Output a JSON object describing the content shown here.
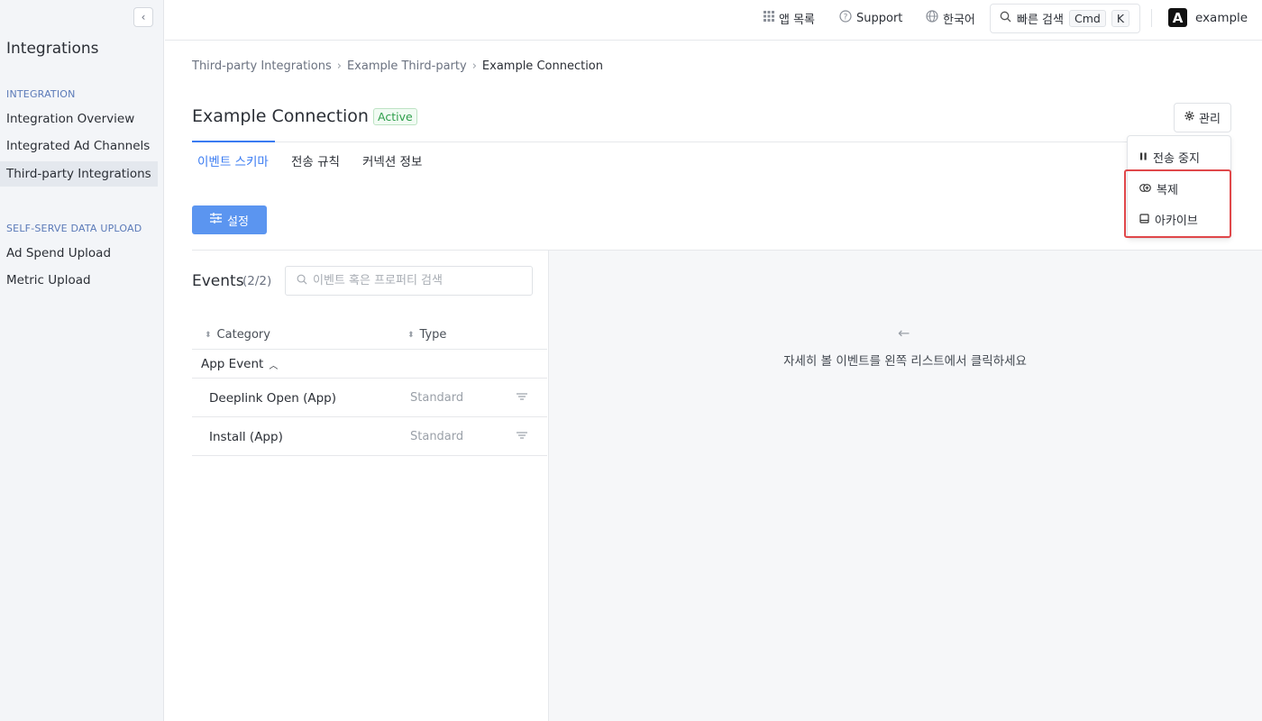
{
  "sidebar": {
    "title": "Integrations",
    "sections": [
      {
        "label": "INTEGRATION",
        "items": [
          "Integration Overview",
          "Integrated Ad Channels",
          "Third-party Integrations"
        ]
      },
      {
        "label": "SELF-SERVE DATA UPLOAD",
        "items": [
          "Ad Spend Upload",
          "Metric Upload"
        ]
      }
    ],
    "active_item": "Third-party Integrations"
  },
  "topbar": {
    "app_list": "앱 목록",
    "support": "Support",
    "language": "한국어",
    "quick_search": "빠른 검색",
    "kbd_cmd": "Cmd",
    "kbd_k": "K",
    "avatar_letter": "A",
    "user": "example"
  },
  "breadcrumb": [
    "Third-party Integrations",
    "Example Third-party",
    "Example Connection"
  ],
  "page": {
    "title": "Example Connection",
    "status": "Active",
    "manage_label": "관리"
  },
  "tabs": [
    "이벤트 스키마",
    "전송 규칙",
    "커넥션 정보"
  ],
  "settings_label": "설정",
  "events": {
    "title": "Events",
    "count": "(2/2)",
    "search_placeholder": "이벤트 혹은 프로퍼티 검색",
    "columns": [
      "Category",
      "Type"
    ],
    "group": "App Event",
    "rows": [
      {
        "name": "Deeplink Open (App)",
        "type": "Standard"
      },
      {
        "name": "Install (App)",
        "type": "Standard"
      }
    ]
  },
  "detail_pane": {
    "message": "자세히 볼 이벤트를 왼쪽 리스트에서 클릭하세요"
  },
  "dropdown": {
    "items": [
      "전송 중지",
      "복제",
      "아카이브"
    ]
  },
  "colors": {
    "accent": "#3a7bf2",
    "button": "#5b95f0",
    "status_green": "#2e9e4b",
    "highlight": "#e0474a"
  }
}
